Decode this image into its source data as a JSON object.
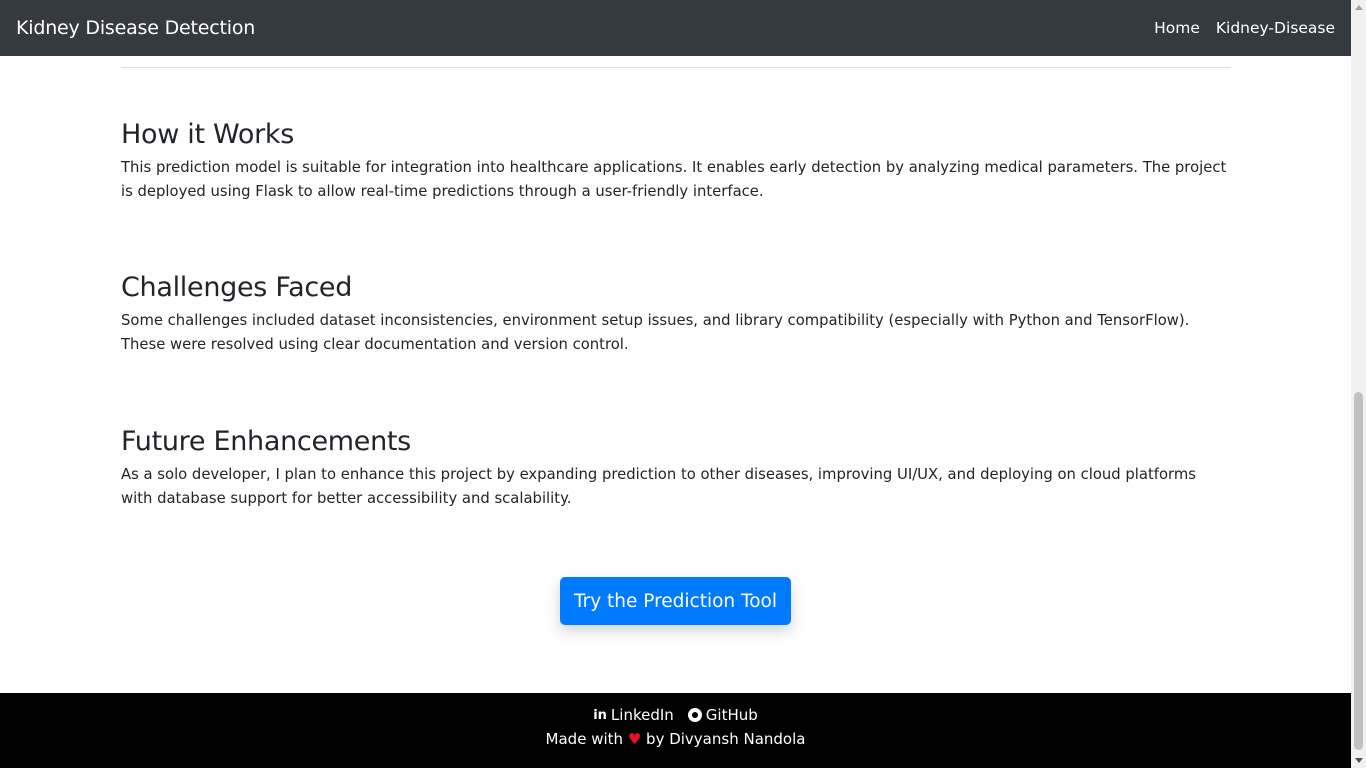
{
  "navbar": {
    "brand": "Kidney Disease Detection",
    "links": [
      "Home",
      "Kidney-Disease"
    ]
  },
  "sections": [
    {
      "heading": "How it Works",
      "body": "This prediction model is suitable for integration into healthcare applications. It enables early detection by analyzing medical parameters. The project is deployed using Flask to allow real-time predictions through a user-friendly interface."
    },
    {
      "heading": "Challenges Faced",
      "body": "Some challenges included dataset inconsistencies, environment setup issues, and library compatibility (especially with Python and TensorFlow). These were resolved using clear documentation and version control."
    },
    {
      "heading": "Future Enhancements",
      "body": "As a solo developer, I plan to enhance this project by expanding prediction to other diseases, improving UI/UX, and deploying on cloud platforms with database support for better accessibility and scalability."
    }
  ],
  "cta": {
    "label": "Try the Prediction Tool"
  },
  "footer": {
    "linkedin_label": "LinkedIn",
    "github_label": "GitHub",
    "credit_prefix": "Made with",
    "heart": "♥",
    "credit_suffix": "by Divyansh Nandola"
  },
  "colors": {
    "navbar_bg": "#343a40",
    "primary": "#007bff",
    "footer_bg": "#000000",
    "heart": "#e81224"
  },
  "icons": [
    "linkedin-icon",
    "github-icon",
    "heart-icon"
  ]
}
